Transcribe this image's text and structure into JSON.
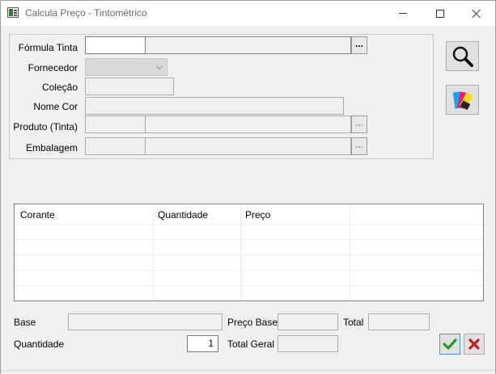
{
  "window": {
    "title": "Calcula Preço - Tintométrico",
    "icon": "form-icon"
  },
  "form": {
    "formula_tinta_label": "Fórmula Tinta",
    "fornecedor_label": "Fornecedor",
    "colecao_label": "Coleção",
    "nome_cor_label": "Nome Cor",
    "produto_label": "Produto (Tinta)",
    "embalagem_label": "Embalagem",
    "ellipsis_label": "..."
  },
  "toolbar": {
    "search_icon": "magnifier-icon",
    "color_icon": "color-palette-icon"
  },
  "grid": {
    "columns": [
      "Corante",
      "Quantidade",
      "Preço"
    ],
    "rows": 5
  },
  "totals": {
    "base_label": "Base",
    "preco_base_label": "Preço Base",
    "total_label": "Total",
    "quantidade_label": "Quantidade",
    "quantidade_value": "1",
    "total_geral_label": "Total Geral"
  },
  "actions": {
    "confirm_icon": "check-icon",
    "cancel_icon": "cancel-icon"
  },
  "colors": {
    "confirm": "#1f9d2a",
    "cancel": "#c8171e",
    "window_bg": "#f0f0f0"
  }
}
